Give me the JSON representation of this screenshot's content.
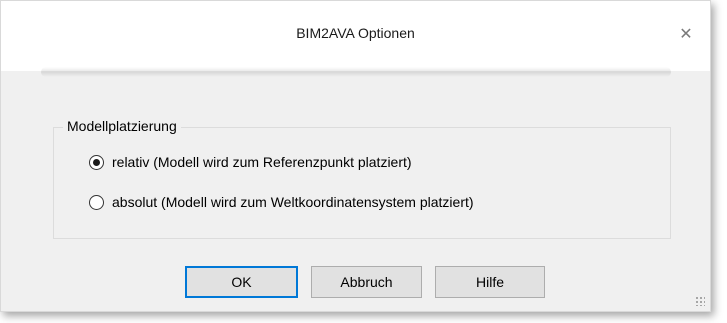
{
  "window": {
    "title": "BIM2AVA Optionen",
    "close_icon": "close-icon"
  },
  "group": {
    "legend": "Modellplatzierung",
    "options": [
      {
        "label": "relativ (Modell wird zum Referenzpunkt platziert)",
        "checked": true
      },
      {
        "label": "absolut (Modell wird zum Weltkoordinatensystem platziert)",
        "checked": false
      }
    ]
  },
  "buttons": {
    "ok": "OK",
    "cancel": "Abbruch",
    "help": "Hilfe"
  },
  "colors": {
    "accent": "#0078d7",
    "dialog_background": "#f0f0f0",
    "titlebar_background": "#ffffff",
    "button_background": "#e1e1e1"
  }
}
